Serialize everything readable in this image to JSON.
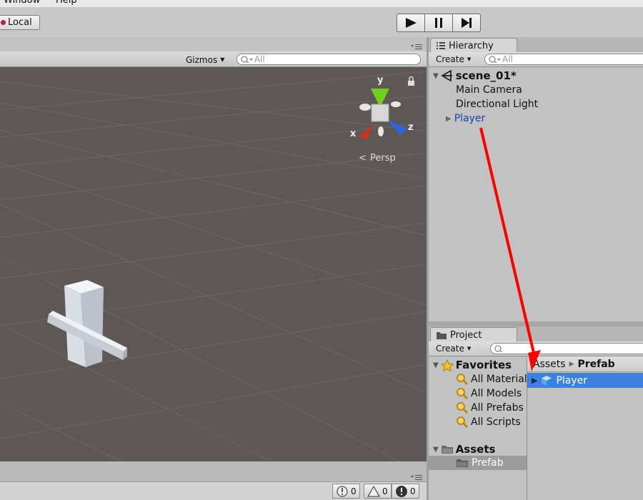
{
  "menu": {
    "items": [
      "Window",
      "Help"
    ]
  },
  "toolbar": {
    "pivot_mode": "Local",
    "play_icon": "play-icon",
    "pause_icon": "pause-icon",
    "step_icon": "step-icon"
  },
  "scene": {
    "gizmos_label": "Gizmos",
    "search_placeholder": "All",
    "projection_label": "Persp",
    "axis_labels": {
      "y": "y",
      "x": "x",
      "z": "z"
    },
    "background_color": "#5d5855"
  },
  "console": {
    "info_count": "0",
    "warning_count": "0",
    "error_count": "0"
  },
  "hierarchy": {
    "tab_label": "Hierarchy",
    "create_label": "Create",
    "search_placeholder": "All",
    "scene_name": "scene_01*",
    "items": [
      "Main Camera",
      "Directional Light",
      "Player"
    ],
    "prefab_text_color": "#1d3fa5"
  },
  "project": {
    "tab_label": "Project",
    "create_label": "Create",
    "favorites": {
      "label": "Favorites",
      "items": [
        "All Materials",
        "All Models",
        "All Prefabs",
        "All Scripts"
      ]
    },
    "assets": {
      "label": "Assets",
      "folders": [
        "Prefab"
      ]
    },
    "breadcrumb": [
      "Assets",
      "Prefab"
    ],
    "assets_items": [
      "Player"
    ],
    "selection_color": "#3d80df"
  },
  "annotation": {
    "arrow_color": "#ff0000"
  }
}
